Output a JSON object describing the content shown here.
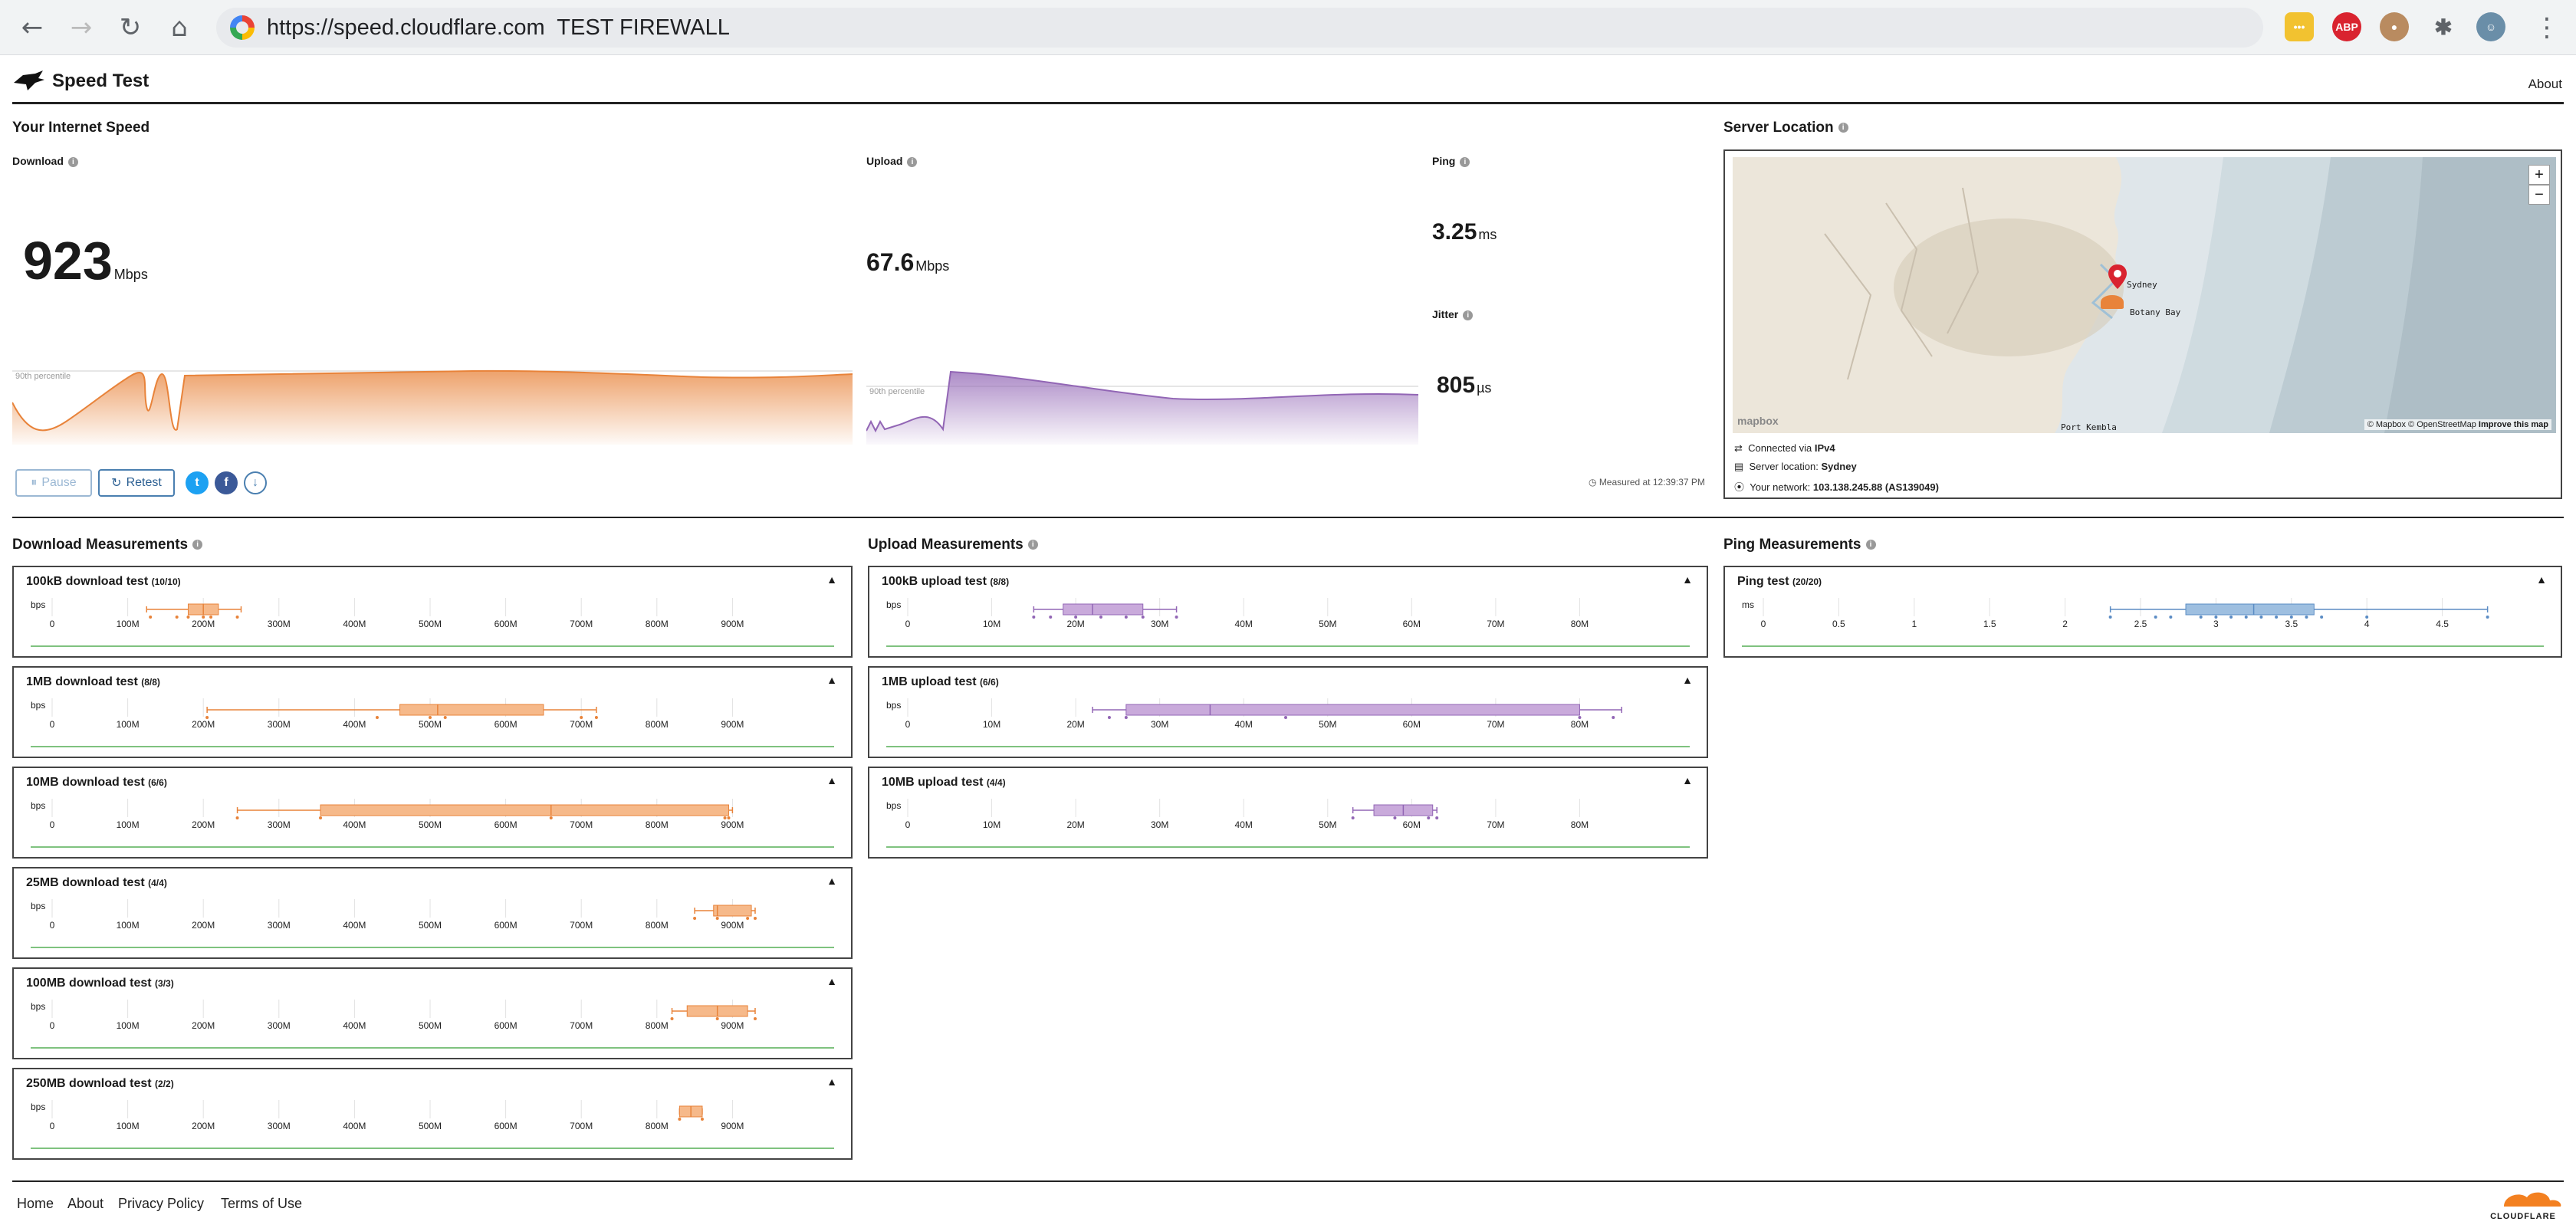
{
  "browser": {
    "url": "https://speed.cloudflare.com",
    "page_note": "TEST FIREWALL",
    "extensions": [
      "mail-icon",
      "abp-icon",
      "toucan-icon",
      "puzzle-icon",
      "avatar"
    ]
  },
  "header": {
    "brand": "Speed Test",
    "about": "About"
  },
  "speed": {
    "title": "Your Internet Speed",
    "download": {
      "label": "Download",
      "value": "923",
      "unit": "Mbps",
      "percentile": "90th percentile"
    },
    "upload": {
      "label": "Upload",
      "value": "67.6",
      "unit": "Mbps",
      "percentile": "90th percentile"
    },
    "ping": {
      "label": "Ping",
      "value": "3.25",
      "unit": "ms"
    },
    "jitter": {
      "label": "Jitter",
      "value": "805",
      "unit": "µs"
    },
    "pause": "Pause",
    "retest": "Retest",
    "measured": "Measured at 12:39:37 PM"
  },
  "server": {
    "title": "Server Location",
    "connected_label": "Connected via",
    "connected": "IPv4",
    "location_label": "Server location:",
    "location": "Sydney",
    "network_label": "Your network:",
    "network": "103.138.245.88 (AS139049)",
    "map_labels": [
      "Sydney",
      "Botany Bay",
      "Port Kembla"
    ],
    "attribution": "© Mapbox © OpenStreetMap",
    "improve": "Improve this map",
    "mapbox": "mapbox",
    "zoom_in": "+",
    "zoom_out": "−"
  },
  "sections": {
    "download": "Download Measurements",
    "upload": "Upload Measurements",
    "ping": "Ping Measurements"
  },
  "colors": {
    "download": "#f6b98a",
    "download_stroke": "#e8833a",
    "upload": "#c9aadb",
    "upload_stroke": "#9266b5",
    "ping": "#9ebfe0",
    "ping_stroke": "#5b8cc4"
  },
  "panels": {
    "download": [
      {
        "title": "100kB download test",
        "count": "(10/10)",
        "unit": "bps",
        "min": 125,
        "q1": 180,
        "med": 200,
        "q3": 220,
        "max": 250,
        "points": [
          130,
          165,
          180,
          200,
          210,
          245
        ]
      },
      {
        "title": "1MB download test",
        "count": "(8/8)",
        "unit": "bps",
        "min": 205,
        "q1": 460,
        "med": 510,
        "q3": 650,
        "max": 720,
        "points": [
          205,
          430,
          500,
          520,
          700,
          720
        ]
      },
      {
        "title": "10MB download test",
        "count": "(6/6)",
        "unit": "bps",
        "min": 245,
        "q1": 355,
        "med": 660,
        "q3": 895,
        "max": 900,
        "points": [
          245,
          355,
          660,
          890,
          895
        ]
      },
      {
        "title": "25MB download test",
        "count": "(4/4)",
        "unit": "bps",
        "min": 850,
        "q1": 875,
        "med": 880,
        "q3": 925,
        "max": 930,
        "points": [
          850,
          880,
          920,
          930
        ]
      },
      {
        "title": "100MB download test",
        "count": "(3/3)",
        "unit": "bps",
        "min": 820,
        "q1": 840,
        "med": 880,
        "q3": 920,
        "max": 930,
        "points": [
          820,
          880,
          930
        ]
      },
      {
        "title": "250MB download test",
        "count": "(2/2)",
        "unit": "bps",
        "min": 830,
        "q1": 830,
        "med": 845,
        "q3": 860,
        "max": 860,
        "points": [
          830,
          860
        ]
      }
    ],
    "download_ticks": [
      "0",
      "100M",
      "200M",
      "300M",
      "400M",
      "500M",
      "600M",
      "700M",
      "800M",
      "900M"
    ],
    "upload": [
      {
        "title": "100kB upload test",
        "count": "(8/8)",
        "unit": "bps",
        "min": 15,
        "q1": 18.5,
        "med": 22,
        "q3": 28,
        "max": 32,
        "points": [
          15,
          17,
          20,
          23,
          26,
          28,
          32
        ]
      },
      {
        "title": "1MB upload test",
        "count": "(6/6)",
        "unit": "bps",
        "min": 22,
        "q1": 26,
        "med": 36,
        "q3": 80,
        "max": 85,
        "points": [
          24,
          26,
          45,
          80,
          84
        ]
      },
      {
        "title": "10MB upload test",
        "count": "(4/4)",
        "unit": "bps",
        "min": 53,
        "q1": 55.5,
        "med": 59,
        "q3": 62.5,
        "max": 63,
        "points": [
          53,
          58,
          62,
          63
        ]
      }
    ],
    "upload_ticks": [
      "0",
      "10M",
      "20M",
      "30M",
      "40M",
      "50M",
      "60M",
      "70M",
      "80M"
    ],
    "ping": [
      {
        "title": "Ping test",
        "count": "(20/20)",
        "unit": "ms",
        "min": 2.3,
        "q1": 2.8,
        "med": 3.25,
        "q3": 3.65,
        "max": 4.8,
        "points": [
          2.3,
          2.6,
          2.7,
          2.9,
          3.0,
          3.1,
          3.2,
          3.3,
          3.4,
          3.5,
          3.6,
          3.7,
          4.0,
          4.8
        ]
      }
    ],
    "ping_ticks": [
      "0",
      "0.5",
      "1",
      "1.5",
      "2",
      "2.5",
      "3",
      "3.5",
      "4",
      "4.5"
    ]
  },
  "footer": {
    "home": "Home",
    "about": "About",
    "privacy": "Privacy Policy",
    "terms": "Terms of Use",
    "logo": "CLOUDFLARE"
  }
}
